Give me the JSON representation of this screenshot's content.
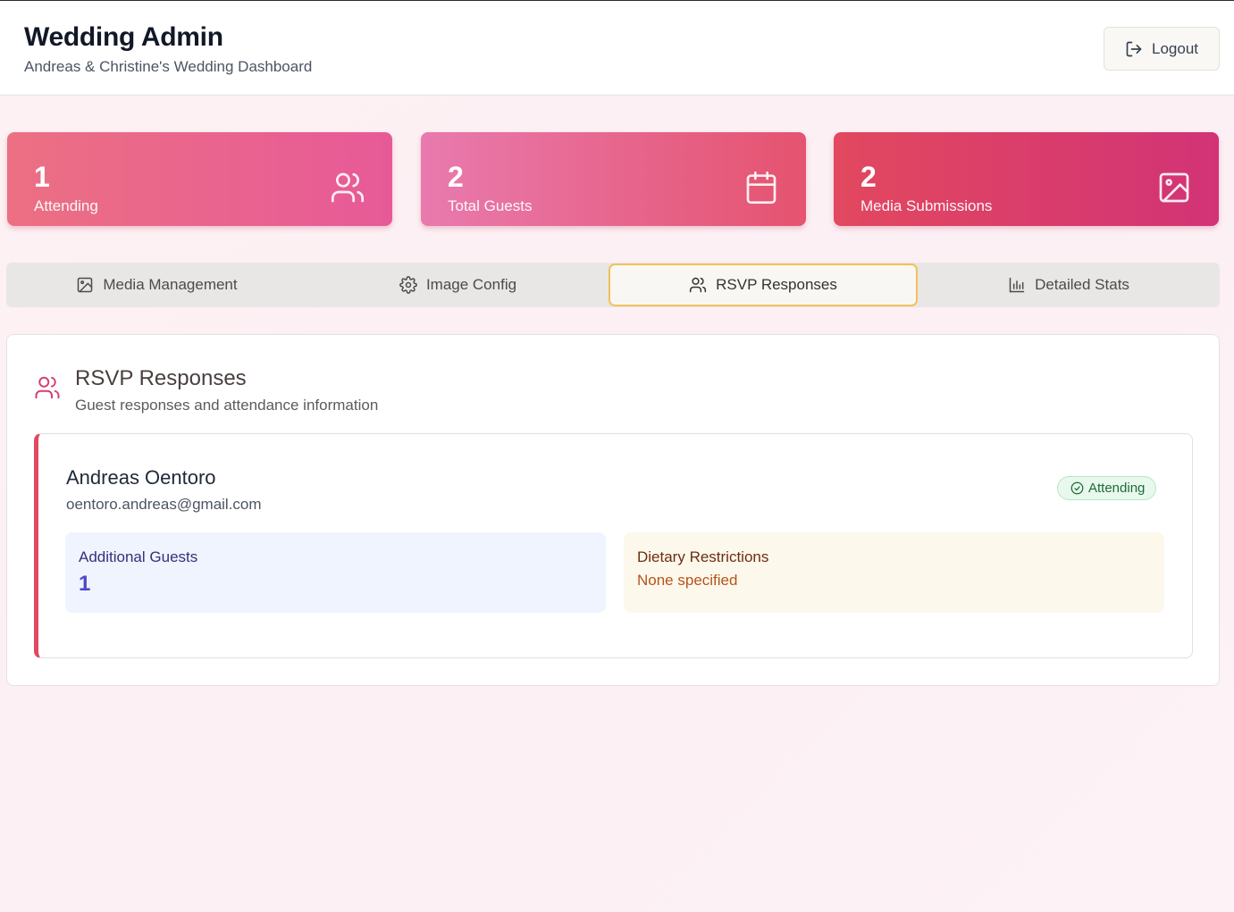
{
  "header": {
    "title": "Wedding Admin",
    "subtitle": "Andreas & Christine's Wedding Dashboard",
    "logout_label": "Logout",
    "logout_icon": "logout-icon"
  },
  "stats": [
    {
      "value": "1",
      "label": "Attending",
      "icon": "users-icon"
    },
    {
      "value": "2",
      "label": "Total Guests",
      "icon": "calendar-icon"
    },
    {
      "value": "2",
      "label": "Media Submissions",
      "icon": "image-icon"
    }
  ],
  "tabs": [
    {
      "label": "Media Management",
      "icon": "image-icon",
      "active": false
    },
    {
      "label": "Image Config",
      "icon": "gear-icon",
      "active": false
    },
    {
      "label": "RSVP Responses",
      "icon": "users-icon",
      "active": true
    },
    {
      "label": "Detailed Stats",
      "icon": "bar-chart-icon",
      "active": false
    }
  ],
  "panel": {
    "title": "RSVP Responses",
    "description": "Guest responses and attendance information",
    "icon": "users-icon"
  },
  "rsvps": [
    {
      "name": "Andreas Oentoro",
      "email": "oentoro.andreas@gmail.com",
      "status": "Attending",
      "status_icon": "check-circle-icon",
      "additional_guests_label": "Additional Guests",
      "additional_guests": "1",
      "dietary_label": "Dietary Restrictions",
      "dietary": "None specified"
    }
  ],
  "colors": {
    "accent": "#e2485f",
    "active_tab_border": "#f1c15c",
    "attending_badge_bg": "#e8f8ec",
    "attending_badge_text": "#1d6b36"
  }
}
